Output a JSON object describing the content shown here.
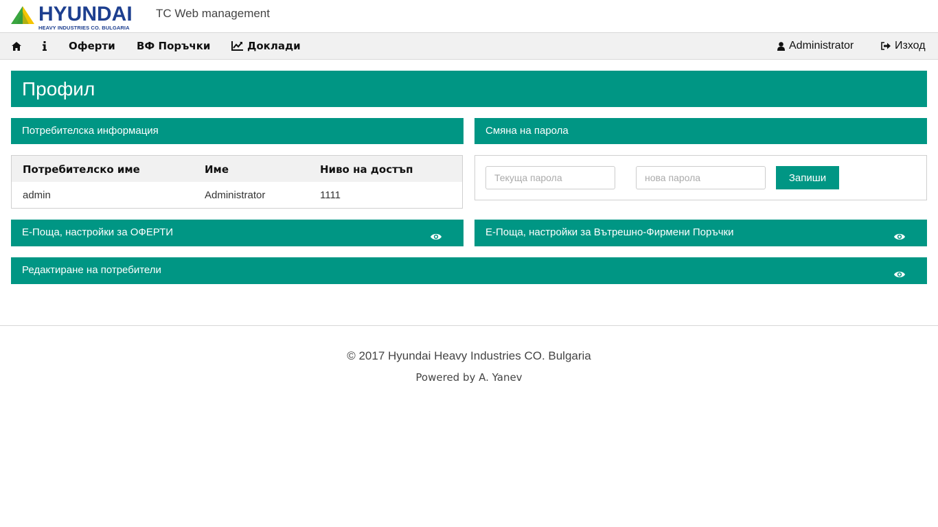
{
  "brand": {
    "logo_text": "HYUNDAI",
    "logo_subtitle": "HEAVY INDUSTRIES CO. BULGARIA",
    "app_title": "TC Web management",
    "colors": {
      "logo_blue": "#1d3f8f",
      "logo_green": "#3aa640",
      "logo_yellow": "#f5c400"
    }
  },
  "navbar": {
    "items": [
      {
        "icon": "home-icon",
        "label": ""
      },
      {
        "icon": "info-icon",
        "label": ""
      },
      {
        "icon": "",
        "label": "Оферти"
      },
      {
        "icon": "",
        "label": "ВФ Поръчки"
      },
      {
        "icon": "chart-line-icon",
        "label": "Доклади"
      }
    ],
    "user": {
      "icon": "user-icon",
      "label": "Administrator"
    },
    "logout": {
      "icon": "logout-icon",
      "label": "Изход"
    }
  },
  "page": {
    "title": "Профил",
    "accent_color": "#009684"
  },
  "user_info": {
    "header": "Потребителска информация",
    "columns": [
      "Потребителско име",
      "Име",
      "Ниво на достъп"
    ],
    "rows": [
      [
        "admin",
        "Administrator",
        "1111"
      ]
    ]
  },
  "password_change": {
    "header": "Смяна на парола",
    "current_placeholder": "Текуща парола",
    "new_placeholder": "нова парола",
    "save_label": "Запиши"
  },
  "sections": {
    "email_offers": {
      "label": "Е-Поща, настройки за ОФЕРТИ",
      "icon": "eye-icon"
    },
    "email_orders": {
      "label": "Е-Поща, настройки за Вътрешно-Фирмени Поръчки",
      "icon": "eye-icon"
    },
    "edit_users": {
      "label": "Редактиране на потребители",
      "icon": "eye-icon"
    }
  },
  "footer": {
    "copyright": "© 2017 Hyundai Heavy Industries CO. Bulgaria",
    "powered": "Powered by A. Yanev"
  }
}
